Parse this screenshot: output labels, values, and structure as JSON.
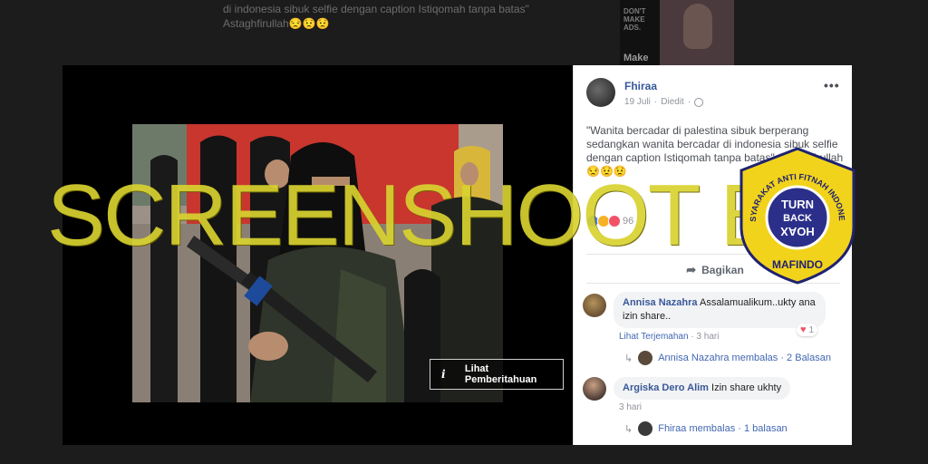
{
  "background": {
    "post_text_line1": "di indonesia sibuk selfie dengan caption Istiqomah tanpa batas\"",
    "post_text_line2": "Astaghfirullah😒😟😟",
    "ad_text": "DON'T MAKE ADS.",
    "ad_make": "Make"
  },
  "viewer": {
    "notice_label": "Lihat Pemberitahuan"
  },
  "post": {
    "author": "Fhiraa",
    "date": "19 Juli",
    "edited": "Diedit",
    "caption": "\"Wanita bercadar di palestina sibuk berperang sedangkan wanita bercadar di indonesia sibuk selfie dengan caption Istiqomah tanpa batas\" Astaghfirullah😒😟😟",
    "reaction_count": "96",
    "share_label": "Bagikan"
  },
  "comments": [
    {
      "name": "Annisa Nazahra",
      "text": "Assalamualikum..ukty ana izin share..",
      "translate": "Lihat Terjemahan",
      "time": "3 hari",
      "reactions": "1",
      "replies": "Annisa Nazahra membalas · 2 Balasan"
    },
    {
      "name": "Argiska Dero Alim",
      "text": "Izin share ukhty",
      "time": "3 hari",
      "replies": "Fhiraa membalas · 1 balasan"
    }
  ],
  "overlay": {
    "watermark": "SCREENSHOOT BY",
    "badge_top": "MASYARAKAT ANTI FITNAH INDONESIA",
    "badge_bottom": "MAFINDO",
    "badge_line1": "TURN",
    "badge_line2": "BACK",
    "badge_line3": "HOAX"
  },
  "colors": {
    "link_blue": "#365899",
    "watermark_yellow": "#d8d230",
    "badge_yellow": "#f2d31b",
    "badge_navy": "#2b2f8a"
  }
}
